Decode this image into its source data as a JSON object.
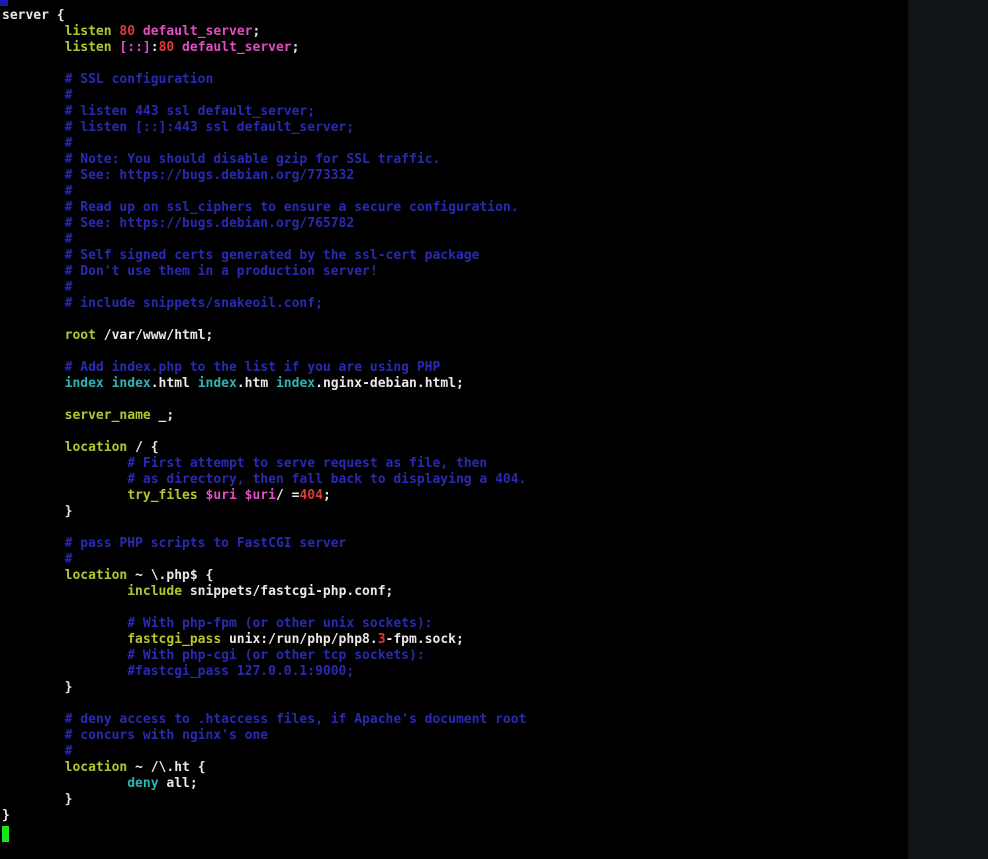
{
  "editor": {
    "name": "nginx-config-editor",
    "lines": [
      [
        [
          "n",
          "server {"
        ]
      ],
      [
        [
          "n",
          "        "
        ],
        [
          "k",
          "listen"
        ],
        [
          "n",
          " "
        ],
        [
          "r",
          "80"
        ],
        [
          "n",
          " "
        ],
        [
          "v",
          "default_server"
        ],
        [
          "n",
          ";"
        ]
      ],
      [
        [
          "n",
          "        "
        ],
        [
          "k",
          "listen"
        ],
        [
          "n",
          " "
        ],
        [
          "v",
          "[::]"
        ],
        [
          "n",
          ":"
        ],
        [
          "r",
          "80"
        ],
        [
          "n",
          " "
        ],
        [
          "v",
          "default_server"
        ],
        [
          "n",
          ";"
        ]
      ],
      [
        [
          "n",
          ""
        ]
      ],
      [
        [
          "n",
          "        "
        ],
        [
          "c",
          "# SSL configuration"
        ]
      ],
      [
        [
          "n",
          "        "
        ],
        [
          "c",
          "#"
        ]
      ],
      [
        [
          "n",
          "        "
        ],
        [
          "c",
          "# listen 443 ssl default_server;"
        ]
      ],
      [
        [
          "n",
          "        "
        ],
        [
          "c",
          "# listen [::]:443 ssl default_server;"
        ]
      ],
      [
        [
          "n",
          "        "
        ],
        [
          "c",
          "#"
        ]
      ],
      [
        [
          "n",
          "        "
        ],
        [
          "c",
          "# Note: You should disable gzip for SSL traffic."
        ]
      ],
      [
        [
          "n",
          "        "
        ],
        [
          "c",
          "# See: https://bugs.debian.org/773332"
        ]
      ],
      [
        [
          "n",
          "        "
        ],
        [
          "c",
          "#"
        ]
      ],
      [
        [
          "n",
          "        "
        ],
        [
          "c",
          "# Read up on ssl_ciphers to ensure a secure configuration."
        ]
      ],
      [
        [
          "n",
          "        "
        ],
        [
          "c",
          "# See: https://bugs.debian.org/765782"
        ]
      ],
      [
        [
          "n",
          "        "
        ],
        [
          "c",
          "#"
        ]
      ],
      [
        [
          "n",
          "        "
        ],
        [
          "c",
          "# Self signed certs generated by the ssl-cert package"
        ]
      ],
      [
        [
          "n",
          "        "
        ],
        [
          "c",
          "# Don't use them in a production server!"
        ]
      ],
      [
        [
          "n",
          "        "
        ],
        [
          "c",
          "#"
        ]
      ],
      [
        [
          "n",
          "        "
        ],
        [
          "c",
          "# include snippets/snakeoil.conf;"
        ]
      ],
      [
        [
          "n",
          ""
        ]
      ],
      [
        [
          "n",
          "        "
        ],
        [
          "k",
          "root"
        ],
        [
          "n",
          " /var/www/html;"
        ]
      ],
      [
        [
          "n",
          ""
        ]
      ],
      [
        [
          "n",
          "        "
        ],
        [
          "c",
          "# Add index.php to the list if you are using PHP"
        ]
      ],
      [
        [
          "n",
          "        "
        ],
        [
          "d",
          "index"
        ],
        [
          "n",
          " "
        ],
        [
          "d",
          "index"
        ],
        [
          "n",
          ".html "
        ],
        [
          "d",
          "index"
        ],
        [
          "n",
          ".htm "
        ],
        [
          "d",
          "index"
        ],
        [
          "n",
          ".nginx-debian.html;"
        ]
      ],
      [
        [
          "n",
          ""
        ]
      ],
      [
        [
          "n",
          "        "
        ],
        [
          "k",
          "server_name"
        ],
        [
          "n",
          " _;"
        ]
      ],
      [
        [
          "n",
          ""
        ]
      ],
      [
        [
          "n",
          "        "
        ],
        [
          "k",
          "location"
        ],
        [
          "n",
          " / {"
        ]
      ],
      [
        [
          "n",
          "                "
        ],
        [
          "c",
          "# First attempt to serve request as file, then"
        ]
      ],
      [
        [
          "n",
          "                "
        ],
        [
          "c",
          "# as directory, then fall back to displaying a 404."
        ]
      ],
      [
        [
          "n",
          "                "
        ],
        [
          "k",
          "try_files"
        ],
        [
          "n",
          " "
        ],
        [
          "v",
          "$uri"
        ],
        [
          "n",
          " "
        ],
        [
          "v",
          "$uri"
        ],
        [
          "n",
          "/ ="
        ],
        [
          "r",
          "404"
        ],
        [
          "n",
          ";"
        ]
      ],
      [
        [
          "n",
          "        }"
        ]
      ],
      [
        [
          "n",
          ""
        ]
      ],
      [
        [
          "n",
          "        "
        ],
        [
          "c",
          "# pass PHP scripts to FastCGI server"
        ]
      ],
      [
        [
          "n",
          "        "
        ],
        [
          "c",
          "#"
        ]
      ],
      [
        [
          "n",
          "        "
        ],
        [
          "k",
          "location"
        ],
        [
          "n",
          " ~ \\.php$ {"
        ]
      ],
      [
        [
          "n",
          "                "
        ],
        [
          "k",
          "include"
        ],
        [
          "n",
          " snippets/fastcgi-php.conf;"
        ]
      ],
      [
        [
          "n",
          ""
        ]
      ],
      [
        [
          "n",
          "                "
        ],
        [
          "c",
          "# With php-fpm (or other unix sockets):"
        ]
      ],
      [
        [
          "n",
          "                "
        ],
        [
          "k",
          "fastcgi_pass"
        ],
        [
          "n",
          " unix:/run/php/php8."
        ],
        [
          "r",
          "3"
        ],
        [
          "n",
          "-fpm.sock;"
        ]
      ],
      [
        [
          "n",
          "                "
        ],
        [
          "c",
          "# With php-cgi (or other tcp sockets):"
        ]
      ],
      [
        [
          "n",
          "                "
        ],
        [
          "c",
          "#fastcgi_pass 127.0.0.1:9000;"
        ]
      ],
      [
        [
          "n",
          "        }"
        ]
      ],
      [
        [
          "n",
          ""
        ]
      ],
      [
        [
          "n",
          "        "
        ],
        [
          "c",
          "# deny access to .htaccess files, if Apache's document root"
        ]
      ],
      [
        [
          "n",
          "        "
        ],
        [
          "c",
          "# concurs with nginx's one"
        ]
      ],
      [
        [
          "n",
          "        "
        ],
        [
          "c",
          "#"
        ]
      ],
      [
        [
          "n",
          "        "
        ],
        [
          "k",
          "location"
        ],
        [
          "n",
          " ~ /\\.ht {"
        ]
      ],
      [
        [
          "n",
          "                "
        ],
        [
          "d",
          "deny"
        ],
        [
          "n",
          " all;"
        ]
      ],
      [
        [
          "n",
          "        }"
        ]
      ],
      [
        [
          "n",
          "}"
        ]
      ]
    ]
  },
  "colors": {
    "background": "#000000",
    "text": "#e8e8e8",
    "keyword": "#b5c62f",
    "directive": "#2fb4b4",
    "comment": "#2a2ab0",
    "variable": "#e14ec2",
    "number": "#e03a3a",
    "cursor": "#19e619",
    "side_pane": "#111417"
  }
}
